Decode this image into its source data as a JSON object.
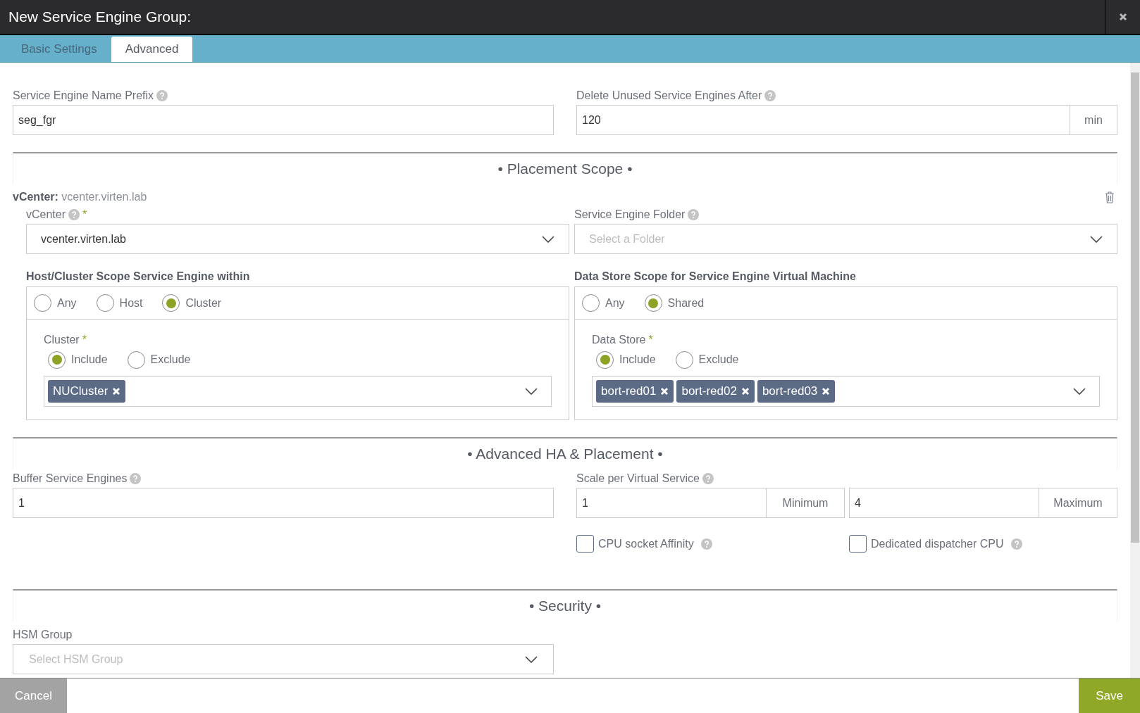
{
  "window": {
    "title": "New Service Engine Group:"
  },
  "tabs": [
    {
      "label": "Basic Settings",
      "selected": false
    },
    {
      "label": "Advanced",
      "selected": true
    }
  ],
  "name_prefix": {
    "label": "Service Engine Name Prefix",
    "value": "seg_fgr"
  },
  "delete_after": {
    "label": "Delete Unused Service Engines After",
    "value": "120",
    "unit": "min"
  },
  "placement_scope": {
    "title": "• Placement Scope •",
    "heading_label": "vCenter:",
    "heading_value": "vcenter.virten.lab",
    "vcenter": {
      "label": "vCenter",
      "required": "*",
      "value": "vcenter.virten.lab"
    },
    "folder": {
      "label": "Service Engine Folder",
      "placeholder": "Select a Folder"
    },
    "scopes": [
      {
        "title": "Host/Cluster Scope Service Engine within",
        "options": [
          {
            "label": "Any",
            "selected": false
          },
          {
            "label": "Host",
            "selected": false
          },
          {
            "label": "Cluster",
            "selected": true
          }
        ],
        "filter_label": "Cluster",
        "required": "*",
        "modes": [
          {
            "label": "Include",
            "selected": true
          },
          {
            "label": "Exclude",
            "selected": false
          }
        ],
        "tags": [
          "NUCluster"
        ]
      },
      {
        "title": "Data Store Scope for Service Engine Virtual Machine",
        "options": [
          {
            "label": "Any",
            "selected": false
          },
          {
            "label": "Shared",
            "selected": true
          }
        ],
        "filter_label": "Data Store",
        "required": "*",
        "modes": [
          {
            "label": "Include",
            "selected": true
          },
          {
            "label": "Exclude",
            "selected": false
          }
        ],
        "tags": [
          "bort-red01",
          "bort-red02",
          "bort-red03"
        ]
      }
    ]
  },
  "advanced_ha": {
    "title": "• Advanced HA & Placement •",
    "buffer": {
      "label": "Buffer Service Engines",
      "value": "1"
    },
    "scale": {
      "label": "Scale per Virtual Service",
      "fields": [
        {
          "value": "1",
          "unit": "Minimum"
        },
        {
          "value": "4",
          "unit": "Maximum"
        }
      ]
    },
    "checkboxes": [
      {
        "label": "CPU socket Affinity",
        "checked": false
      },
      {
        "label": "Dedicated dispatcher CPU",
        "checked": false
      }
    ]
  },
  "security": {
    "title": "• Security •",
    "hsm": {
      "label": "HSM Group",
      "placeholder": "Select HSM Group"
    }
  },
  "footer": {
    "cancel": "Cancel",
    "save": "Save"
  }
}
